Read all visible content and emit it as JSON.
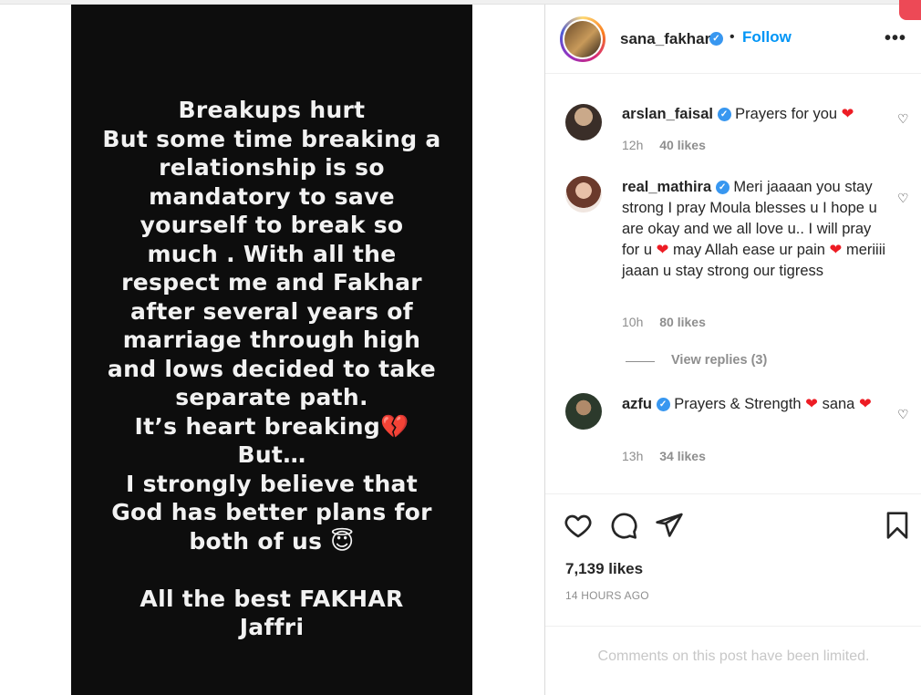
{
  "story": {
    "text_lines": [
      "Breakups hurt",
      "But some time breaking a",
      "relationship is so",
      "mandatory to save",
      "yourself to break so",
      "much . With all the",
      "respect me and Fakhar",
      "after several years of",
      "marriage through high",
      "and lows decided to take",
      "separate path.",
      "It’s heart breaking💔",
      "But…",
      "I strongly believe that",
      "God has better plans for",
      "both of us 😇",
      "",
      "All the best FAKHAR",
      "Jaffri"
    ]
  },
  "header": {
    "username": "sana_fakhar",
    "verified_icon": "verified-badge-icon",
    "separator": "•",
    "follow_label": "Follow",
    "more_icon": "more-options-icon",
    "more_label": "•••"
  },
  "comments": [
    {
      "username": "arslan_faisal",
      "text": "Prayers for you",
      "time": "12h",
      "likes": "40 likes"
    },
    {
      "username": "real_mathira",
      "text": "Meri jaaaan you stay strong I pray Moula blesses u I hope u are okay and we all love u.. I will pray for u ",
      "text2": " may Allah ease ur pain ",
      "text3": " meriiii jaaan u stay strong our tigress",
      "time": "10h",
      "likes": "80 likes"
    },
    {
      "username": "azfu",
      "text": "Prayers & Strength ",
      "text2": " sana",
      "time": "13h",
      "likes": "34 likes"
    }
  ],
  "view_replies": "View replies (3)",
  "heart_glyph": "❤",
  "like_glyph": "♡",
  "actions": {
    "like_icon": "heart-icon",
    "comment_icon": "comment-icon",
    "share_icon": "share-icon",
    "save_icon": "bookmark-icon"
  },
  "post": {
    "likes": "7,139 likes",
    "timestamp": "14 HOURS AGO"
  },
  "footer": {
    "limited_text": "Comments on this post have been limited."
  },
  "colors": {
    "accent": "#0095f6",
    "verified": "#3897f0",
    "heart": "#ed1c24",
    "muted": "#8e8e8e"
  }
}
